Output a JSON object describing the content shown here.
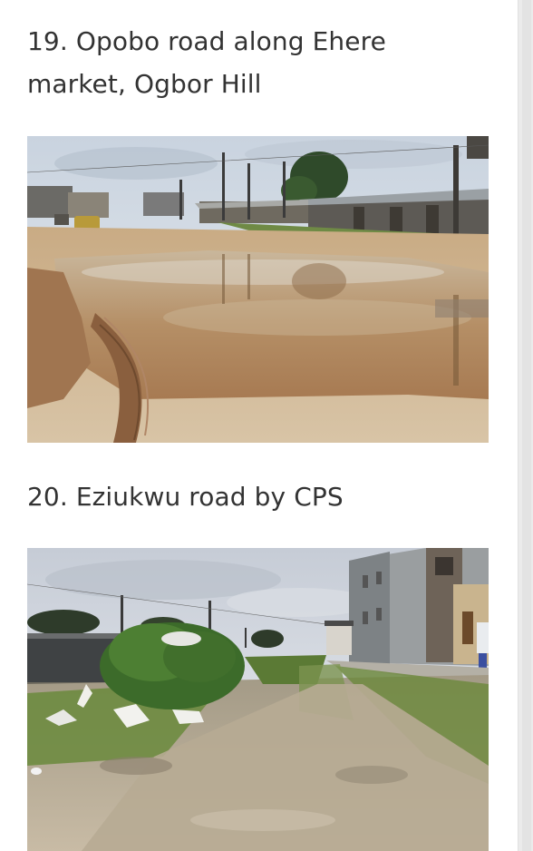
{
  "article": {
    "items": [
      {
        "caption": "19. Opobo road along Ehere market, Ogbor Hill",
        "image_alt": "Flooded road with muddy water along market stalls"
      },
      {
        "caption": "20. Eziukwu road by CPS",
        "image_alt": "Unpaved overgrown road beside buildings"
      }
    ]
  }
}
